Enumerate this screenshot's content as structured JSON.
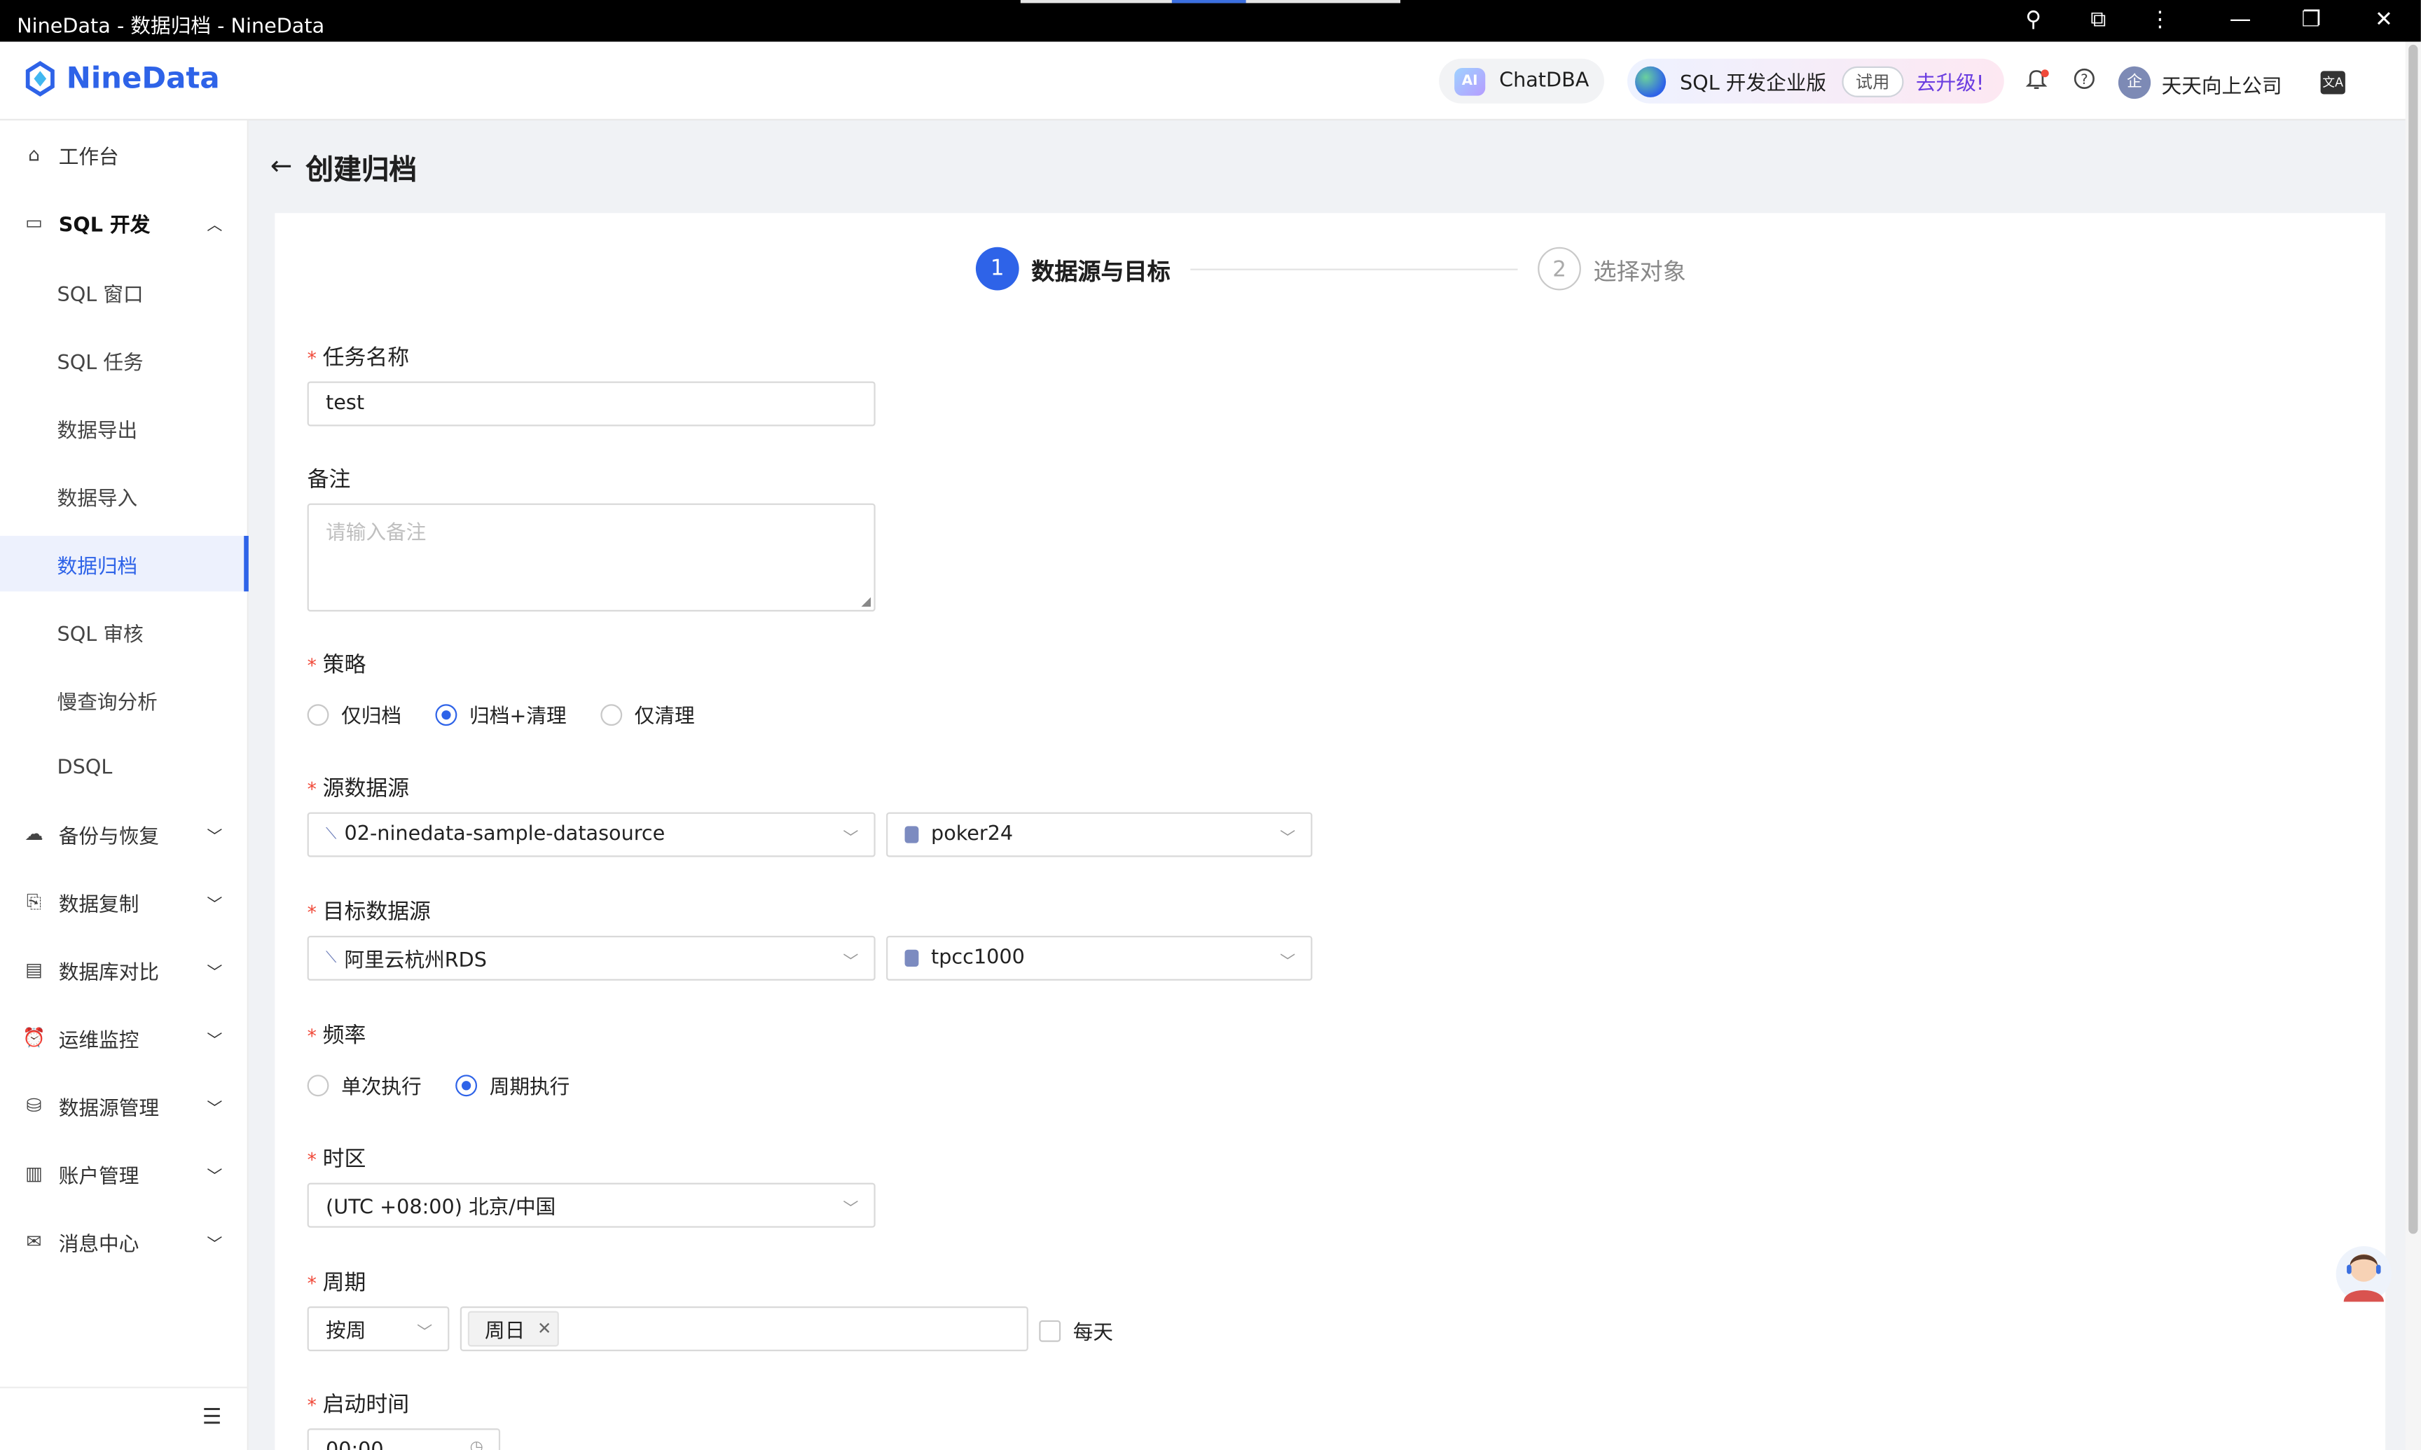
{
  "window": {
    "title": "NineData - 数据归档 - NineData"
  },
  "header": {
    "brand": "NineData",
    "chatdba": "ChatDBA",
    "ai_badge": "AI",
    "edition": "SQL 开发企业版",
    "trial_tag": "试用",
    "upgrade": "去升级!",
    "company": "天天向上公司",
    "avatar_initial": "企"
  },
  "sidebar": {
    "workbench": "工作台",
    "sql_dev": "SQL 开发",
    "sub_items": [
      "SQL 窗口",
      "SQL 任务",
      "数据导出",
      "数据导入",
      "数据归档",
      "SQL 审核",
      "慢查询分析",
      "DSQL"
    ],
    "active_sub": "数据归档",
    "groups": [
      "备份与恢复",
      "数据复制",
      "数据库对比",
      "运维监控",
      "数据源管理",
      "账户管理",
      "消息中心"
    ]
  },
  "page": {
    "title": "创建归档"
  },
  "steps": [
    {
      "num": "1",
      "label": "数据源与目标",
      "state": "active"
    },
    {
      "num": "2",
      "label": "选择对象",
      "state": "pending"
    }
  ],
  "form": {
    "task_name": {
      "label": "任务名称",
      "value": "test"
    },
    "remark": {
      "label": "备注",
      "placeholder": "请输入备注"
    },
    "strategy": {
      "label": "策略",
      "options": [
        "仅归档",
        "归档+清理",
        "仅清理"
      ],
      "selected": "归档+清理"
    },
    "source": {
      "label": "源数据源",
      "datasource": "02-ninedata-sample-datasource",
      "database": "poker24"
    },
    "target": {
      "label": "目标数据源",
      "datasource": "阿里云杭州RDS",
      "database": "tpcc1000"
    },
    "frequency": {
      "label": "频率",
      "options": [
        "单次执行",
        "周期执行"
      ],
      "selected": "周期执行"
    },
    "timezone": {
      "label": "时区",
      "value": "(UTC +08:00) 北京/中国"
    },
    "period": {
      "label": "周期",
      "unit": "按周",
      "days": [
        "周日"
      ],
      "everyday_label": "每天",
      "everyday_checked": false
    },
    "start_time": {
      "label": "启动时间",
      "value": "00:00"
    }
  },
  "colors": {
    "accent": "#2e63e8",
    "required": "#f04a3a"
  }
}
